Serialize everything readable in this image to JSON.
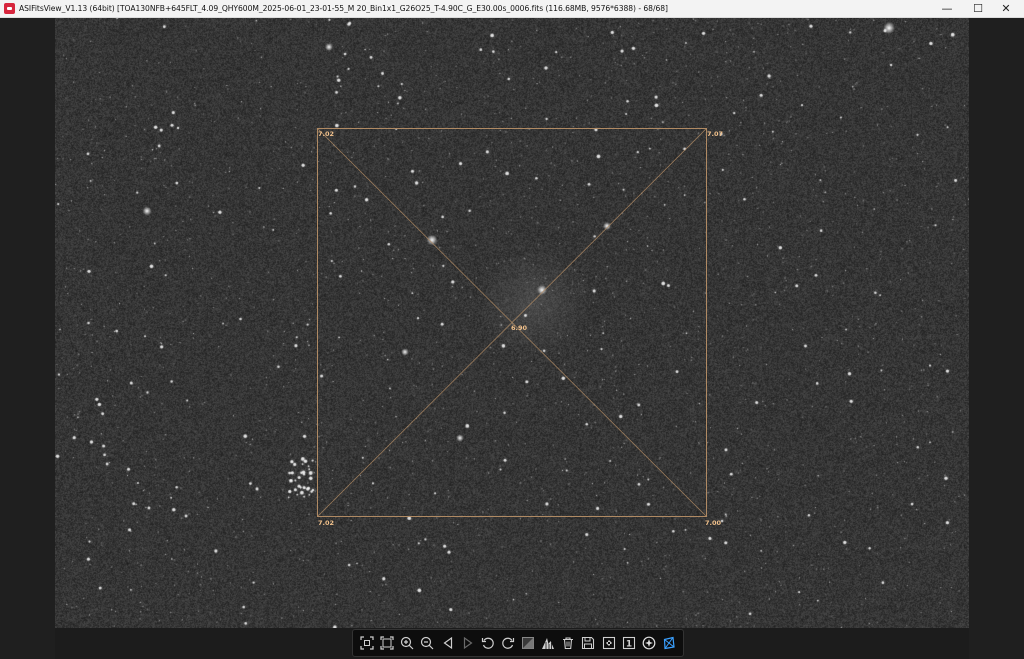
{
  "window": {
    "title": "ASIFitsView_V1.13 (64bit) [TOA130NFB+645FLT_4.09_QHY600M_2025-06-01_23-01-55_M 20_Bin1x1_G26O25_T-4.90C_G_E30.00s_0006.fits (116.68MB, 9576*6388) - 68/68]",
    "controls": {
      "minimize": "—",
      "maximize": "☐",
      "close": "✕"
    }
  },
  "overlay": {
    "fwhm": {
      "top_left": "7.02",
      "top_right": "7.07",
      "center": "6.90",
      "bottom_left": "7.02",
      "bottom_right": "7.00"
    },
    "colors": {
      "frame": "#b08a63",
      "label": "#f2c28c"
    }
  },
  "toolbar": {
    "buttons": [
      {
        "name": "fit-window-button",
        "icon": "fit-window-icon"
      },
      {
        "name": "actual-size-button",
        "icon": "actual-size-icon"
      },
      {
        "name": "zoom-in-button",
        "icon": "zoom-in-icon"
      },
      {
        "name": "zoom-out-button",
        "icon": "zoom-out-icon"
      },
      {
        "name": "previous-image-button",
        "icon": "triangle-left-icon"
      },
      {
        "name": "next-image-button",
        "icon": "triangle-right-icon"
      },
      {
        "name": "rotate-left-button",
        "icon": "rotate-ccw-icon"
      },
      {
        "name": "rotate-right-button",
        "icon": "rotate-cw-icon"
      },
      {
        "name": "stretch-button",
        "icon": "stretch-icon"
      },
      {
        "name": "histogram-button",
        "icon": "histogram-icon"
      },
      {
        "name": "delete-button",
        "icon": "trash-icon"
      },
      {
        "name": "save-button",
        "icon": "save-icon"
      },
      {
        "name": "fullscreen-button",
        "icon": "fullscreen-icon"
      },
      {
        "name": "one-to-one-button",
        "icon": "one-to-one-icon",
        "label": "1"
      },
      {
        "name": "star-detect-button",
        "icon": "star-detect-icon"
      },
      {
        "name": "tilt-analysis-button",
        "icon": "tilt-analysis-icon"
      }
    ],
    "accent": "#3aa0ff"
  }
}
